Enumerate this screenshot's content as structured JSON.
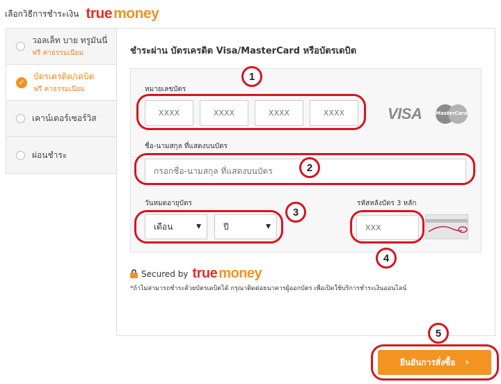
{
  "header": {
    "title": "เลือกวิธีการชำระเงิน",
    "logo_true": "true",
    "logo_money": "money"
  },
  "sidebar": {
    "items": [
      {
        "label": "วอลเล็ท บาย ทรูมันนี่",
        "sub": "ฟรี ค่าธรรมเนียม",
        "selected": false
      },
      {
        "label": "บัตรเครดิต/เดบิต",
        "sub": "ฟรี ค่าธรรมเนียม",
        "selected": true
      },
      {
        "label": "เคาน์เตอร์เซอร์วิส",
        "sub": "",
        "selected": false
      },
      {
        "label": "ผ่อนชำระ",
        "sub": "",
        "selected": false
      }
    ]
  },
  "panel": {
    "title": "ชำระผ่าน บัตรเครดิต Visa/MasterCard หรือบัตรเดบิต",
    "card_number_label": "หมายเลขบัตร",
    "card_number_placeholders": [
      "XXXX",
      "XXXX",
      "XXXX",
      "XXXX"
    ],
    "card_brands": {
      "visa": "VISA",
      "mastercard": "MasterCard"
    },
    "name_label": "ชื่อ-นามสกุล ที่แสดงบนบัตร",
    "name_placeholder": "กรอกชื่อ-นามสกุล ที่แสดงบนบัตร",
    "expiry_label": "วันหมดอายุบัตร",
    "month_value": "เดือน",
    "year_value": "ปี",
    "cvv_label": "รหัสหลังบัตร 3 หลัก",
    "cvv_placeholder": "XXX",
    "secured_text": "Secured by",
    "secured_logo_true": "true",
    "secured_logo_money": "money",
    "note": "*ถ้าไม่สามารถชำระด้วยบัตรเดบิตได้ กรุณาติดต่อธนาคารผู้ออกบัตร เพื่อเปิดใช้บริการชำระเงินออนไลน์"
  },
  "confirm_button": {
    "label": "ยืนยันการสั่งซื้อ",
    "chevron": "›"
  },
  "annotations": [
    "1",
    "2",
    "3",
    "4",
    "5"
  ],
  "colors": {
    "accent": "#f39322",
    "brand_red": "#e4302b",
    "annotation": "#d9121f"
  }
}
